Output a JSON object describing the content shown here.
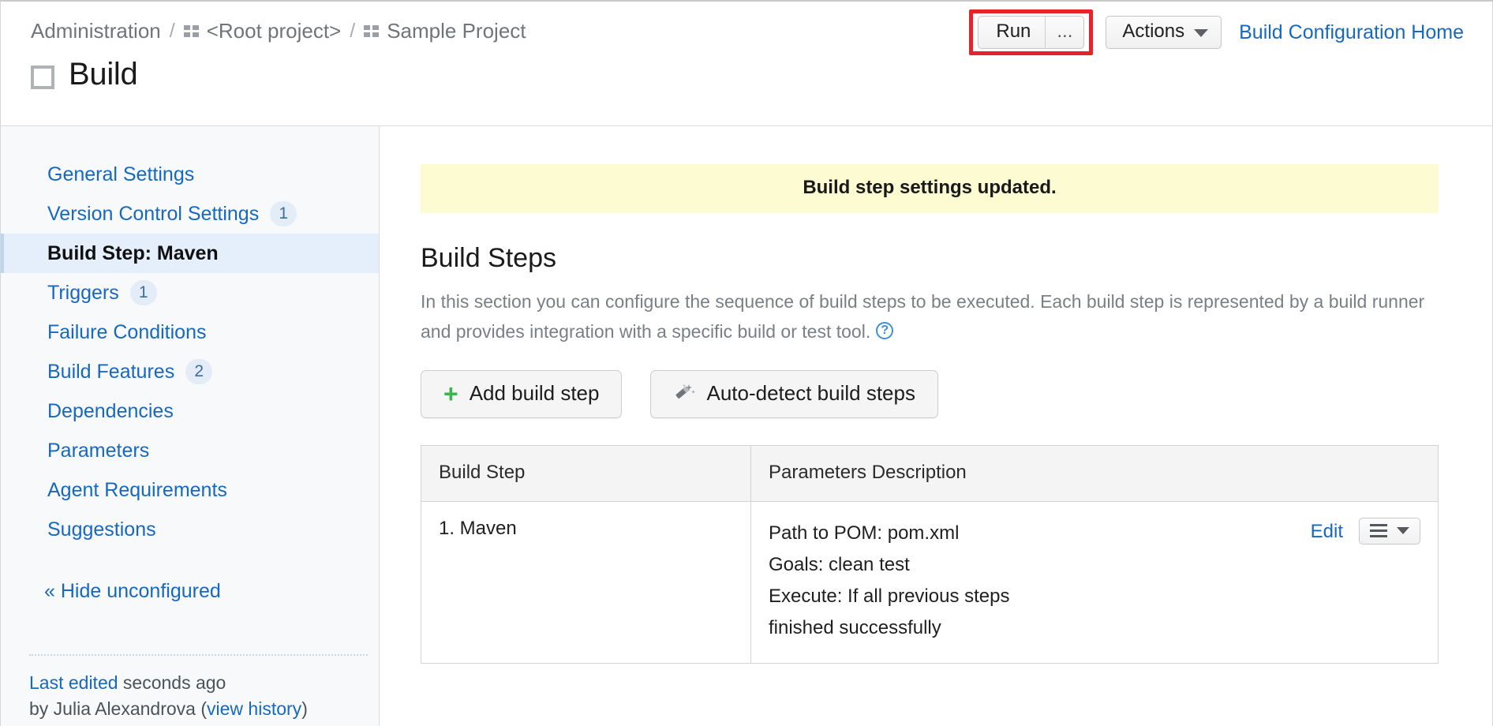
{
  "breadcrumb": {
    "items": [
      {
        "label": "Administration",
        "icon": null
      },
      {
        "label": "<Root project>",
        "icon": "grid-icon"
      },
      {
        "label": "Sample Project",
        "icon": "grid-icon"
      }
    ],
    "separator": "/"
  },
  "header": {
    "title": "Build",
    "run_button": "Run",
    "run_more_button": "...",
    "actions_button": "Actions",
    "home_link": "Build Configuration Home",
    "highlight_color": "#e8222a"
  },
  "sidebar": {
    "items": [
      {
        "label": "General Settings",
        "badge": null,
        "active": false
      },
      {
        "label": "Version Control Settings",
        "badge": "1",
        "active": false
      },
      {
        "label": "Build Step: Maven",
        "badge": null,
        "active": true
      },
      {
        "label": "Triggers",
        "badge": "1",
        "active": false
      },
      {
        "label": "Failure Conditions",
        "badge": null,
        "active": false
      },
      {
        "label": "Build Features",
        "badge": "2",
        "active": false
      },
      {
        "label": "Dependencies",
        "badge": null,
        "active": false
      },
      {
        "label": "Parameters",
        "badge": null,
        "active": false
      },
      {
        "label": "Agent Requirements",
        "badge": null,
        "active": false
      },
      {
        "label": "Suggestions",
        "badge": null,
        "active": false
      }
    ],
    "hide_unconfigured": "« Hide unconfigured",
    "footer": {
      "last_edited_link": "Last edited",
      "last_edited_time": "seconds ago",
      "by_text": "by Julia Alexandrova",
      "view_history_open": "(",
      "view_history_link": "view history",
      "view_history_close": ")"
    }
  },
  "main": {
    "notice": "Build step settings updated.",
    "section_title": "Build Steps",
    "section_desc": "In this section you can configure the sequence of build steps to be executed. Each build step is represented by a build runner and provides integration with a specific build or test tool.",
    "help_icon_char": "?",
    "add_build_step_button": "Add build step",
    "add_icon": "plus-icon",
    "auto_detect_button": "Auto-detect build steps",
    "auto_detect_icon": "magic-wand-icon",
    "table": {
      "headers": [
        "Build Step",
        "Parameters Description"
      ],
      "rows": [
        {
          "step": "1. Maven",
          "params": [
            "Path to POM: pom.xml",
            "Goals: clean test",
            "Execute: If all previous steps finished successfully"
          ],
          "edit_label": "Edit"
        }
      ]
    }
  }
}
